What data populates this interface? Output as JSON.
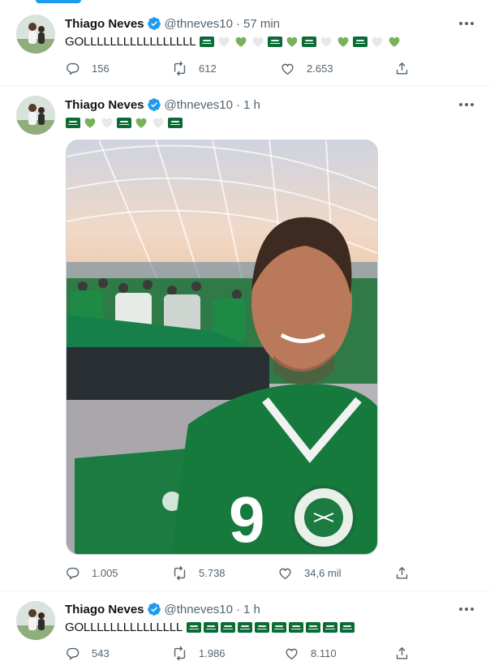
{
  "tweets": [
    {
      "name": "Thiago Neves",
      "handle": "@thneves10",
      "separator": "·",
      "time": "57 min",
      "text": "GOLLLLLLLLLLLLLLLLL",
      "emojis": [
        "flag",
        "white-heart",
        "green-heart",
        "white-heart",
        "flag",
        "green-heart",
        "flag",
        "white-heart",
        "green-heart",
        "flag",
        "white-heart",
        "green-heart"
      ],
      "replies": "156",
      "retweets": "612",
      "likes": "2.653"
    },
    {
      "name": "Thiago Neves",
      "handle": "@thneves10",
      "separator": "·",
      "time": "1 h",
      "text": "",
      "emojis": [
        "flag",
        "green-heart",
        "white-heart",
        "flag",
        "green-heart",
        "white-heart",
        "flag"
      ],
      "replies": "1.005",
      "retweets": "5.738",
      "likes": "34,6 mil",
      "media": {
        "alt": "Selfie of a man in a green Saudi Arabia football jersey with the number 9 inside a stadium",
        "jersey_number": "9"
      }
    },
    {
      "name": "Thiago Neves",
      "handle": "@thneves10",
      "separator": "·",
      "time": "1 h",
      "text": "GOLLLLLLLLLLLLLLL",
      "emojis": [
        "flag",
        "flag",
        "flag",
        "flag",
        "flag",
        "flag",
        "flag",
        "flag",
        "flag",
        "flag"
      ],
      "replies": "543",
      "retweets": "1.986",
      "likes": "8.110"
    }
  ],
  "colors": {
    "accent": "#1d9bf0",
    "text_primary": "#0f1419",
    "text_secondary": "#536471",
    "flag_green": "#0b6b35",
    "heart_green": "#78b159",
    "heart_white": "#e8e8e8"
  },
  "icons": {
    "verified": "verified-badge-icon",
    "more": "more-icon",
    "reply": "reply-icon",
    "retweet": "retweet-icon",
    "like": "like-icon",
    "share": "share-icon"
  }
}
